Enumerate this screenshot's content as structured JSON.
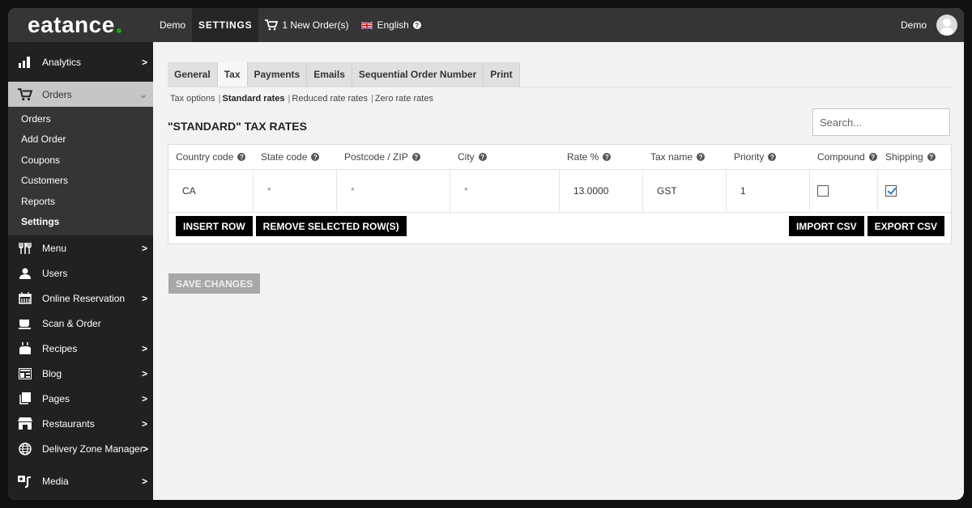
{
  "topbar": {
    "logo": "eatance",
    "demo_label": "Demo",
    "settings_label": "SETTINGS",
    "orders_label": "1 New Order(s)",
    "language_label": "English",
    "user_name": "Demo"
  },
  "sidebar": {
    "items": [
      {
        "label": "Analytics",
        "icon": "bar-chart-icon",
        "has_chevron": true
      },
      {
        "label": "Orders",
        "icon": "cart-icon",
        "expanded": true
      },
      {
        "label": "Menu",
        "icon": "utensils-icon",
        "has_chevron": true
      },
      {
        "label": "Users",
        "icon": "user-icon",
        "has_chevron": false
      },
      {
        "label": "Online Reservation",
        "icon": "calendar-icon",
        "has_chevron": true
      },
      {
        "label": "Scan & Order",
        "icon": "coffee-cup-icon",
        "has_chevron": false
      },
      {
        "label": "Recipes",
        "icon": "cake-icon",
        "has_chevron": true
      },
      {
        "label": "Blog",
        "icon": "newspaper-icon",
        "has_chevron": true
      },
      {
        "label": "Pages",
        "icon": "pages-icon",
        "has_chevron": true
      },
      {
        "label": "Restaurants",
        "icon": "storefront-icon",
        "has_chevron": true
      },
      {
        "label": "Delivery Zone Manager",
        "icon": "globe-icon",
        "has_chevron": true
      },
      {
        "label": "Media",
        "icon": "media-icon",
        "has_chevron": true
      }
    ],
    "orders_sub": [
      "Orders",
      "Add Order",
      "Coupons",
      "Customers",
      "Reports",
      "Settings"
    ],
    "chevron_right": ">",
    "chevron_down": "⌄"
  },
  "tabs": [
    "General",
    "Tax",
    "Payments",
    "Emails",
    "Sequential Order Number",
    "Print"
  ],
  "active_tab": "Tax",
  "subnav": {
    "items": [
      "Tax options",
      "Standard rates",
      "Reduced rate rates",
      "Zero rate rates"
    ],
    "separator": "|",
    "active": "Standard rates"
  },
  "page_title": "\"STANDARD\" TAX RATES",
  "search": {
    "placeholder": "Search...",
    "value": ""
  },
  "table": {
    "columns": [
      "Country code",
      "State code",
      "Postcode / ZIP",
      "City",
      "Rate %",
      "Tax name",
      "Priority",
      "Compound",
      "Shipping"
    ],
    "help_glyph": "?",
    "rows": [
      {
        "country": "CA",
        "state": "*",
        "postcode": "*",
        "city": "*",
        "rate": "13.0000",
        "name": "GST",
        "priority": "1",
        "compound": false,
        "shipping": true
      }
    ]
  },
  "buttons": {
    "insert_row": "INSERT ROW",
    "remove_rows": "REMOVE SELECTED ROW(S)",
    "import_csv": "IMPORT CSV",
    "export_csv": "EXPORT CSV",
    "save_changes": "SAVE CHANGES"
  },
  "colors": {
    "logo_dot": "#1aa01a",
    "topbar_bg": "#353535",
    "sidebar_bg": "#212121",
    "checkbox_check": "#2a7dc0"
  }
}
